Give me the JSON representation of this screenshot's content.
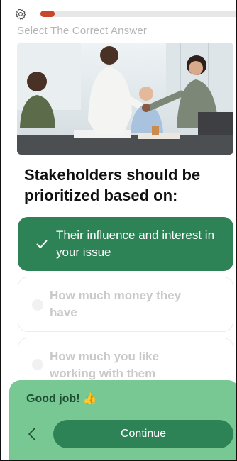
{
  "header": {
    "progress_fraction": 0.07,
    "progress_color": "#c8462a",
    "settings_icon": "gear-icon"
  },
  "instruction": "Select The Correct Answer",
  "question": "Stakeholders should be prioritized based on:",
  "options": [
    {
      "label": "Their influence and interest in your issue",
      "state": "correct"
    },
    {
      "label": "How much money they have",
      "state": "unselected"
    },
    {
      "label": "How much you like working with them",
      "state": "unselected"
    }
  ],
  "feedback": {
    "message": "Good job!",
    "emoji": "👍",
    "continue_label": "Continue",
    "back_icon": "chevron-left-icon"
  },
  "colors": {
    "accent_green": "#2d8256",
    "feedback_bg": "#78c894"
  }
}
